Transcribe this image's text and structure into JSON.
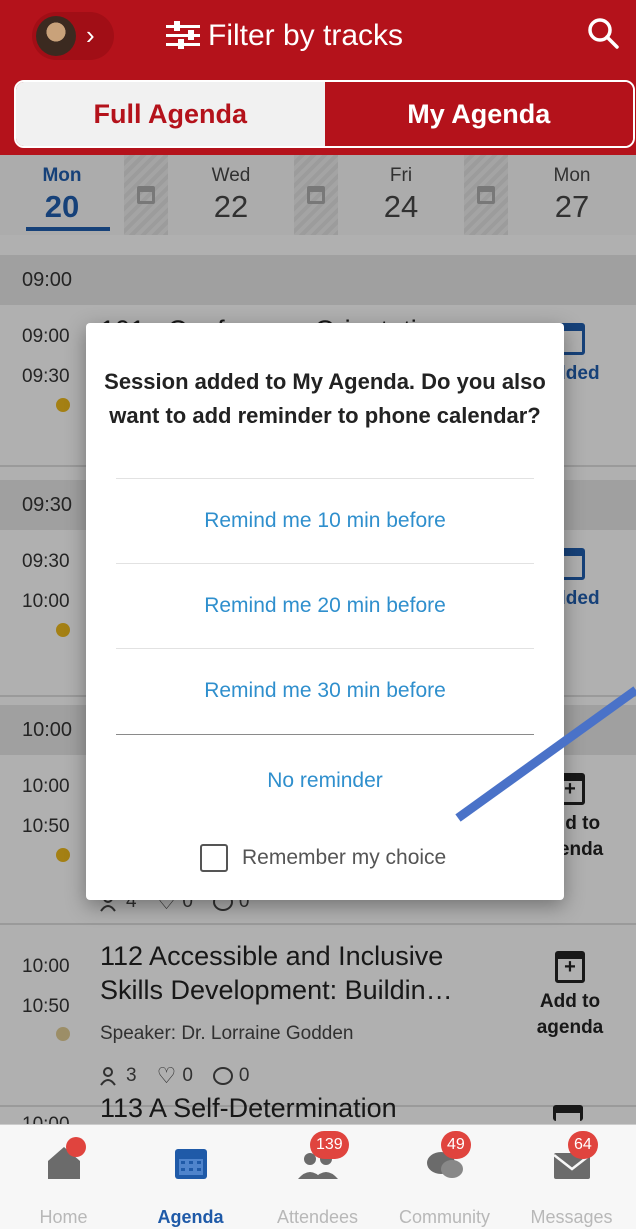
{
  "header": {
    "filter_label": "Filter by tracks",
    "tabs": [
      {
        "label": "Full Agenda",
        "active": true
      },
      {
        "label": "My Agenda",
        "active": false
      }
    ]
  },
  "dates": [
    {
      "dow": "Mon",
      "num": "20",
      "selected": true
    },
    {
      "dow": "Wed",
      "num": "22",
      "selected": false
    },
    {
      "dow": "Fri",
      "num": "24",
      "selected": false
    },
    {
      "dow": "Mon",
      "num": "27",
      "selected": false
    }
  ],
  "agenda": {
    "hours": [
      "09:00",
      "09:30",
      "10:00"
    ],
    "sessions": [
      {
        "start": "09:00",
        "end": "09:30",
        "title": "101a Conference Orientation",
        "action": "Added"
      },
      {
        "start": "09:30",
        "end": "10:00",
        "title": "",
        "action": "Added"
      },
      {
        "start": "10:00",
        "end": "10:50",
        "title": "",
        "action_line1": "Add to",
        "action_line2": "agenda",
        "stats": {
          "attendees": "4",
          "likes": "0",
          "comments": "0"
        }
      },
      {
        "start": "10:00",
        "end": "10:50",
        "title_line1": "112 Accessible and Inclusive",
        "title_line2": "Skills Development: Buildin…",
        "speaker": "Speaker: Dr. Lorraine Godden",
        "action_line1": "Add to",
        "action_line2": "agenda",
        "stats": {
          "attendees": "3",
          "likes": "0",
          "comments": "0"
        }
      },
      {
        "start": "10:00",
        "title": "113 A Self-Determination"
      }
    ]
  },
  "dialog": {
    "message": "Session added to My Agenda.  Do you also want to add reminder to phone calendar?",
    "options": [
      "Remind me 10 min before",
      "Remind me 20 min before",
      "Remind me 30 min before"
    ],
    "no_reminder": "No reminder",
    "remember": "Remember my choice"
  },
  "nav": [
    {
      "label": "Home",
      "badge": ""
    },
    {
      "label": "Agenda",
      "badge": ""
    },
    {
      "label": "Attendees",
      "badge": "139"
    },
    {
      "label": "Community",
      "badge": "49"
    },
    {
      "label": "Messages",
      "badge": "64"
    }
  ],
  "colors": {
    "brand_red": "#b4121b",
    "accent_blue": "#1f5aa8",
    "link_blue": "#2f8fcd",
    "annotation_arrow": "#4a72c8"
  }
}
